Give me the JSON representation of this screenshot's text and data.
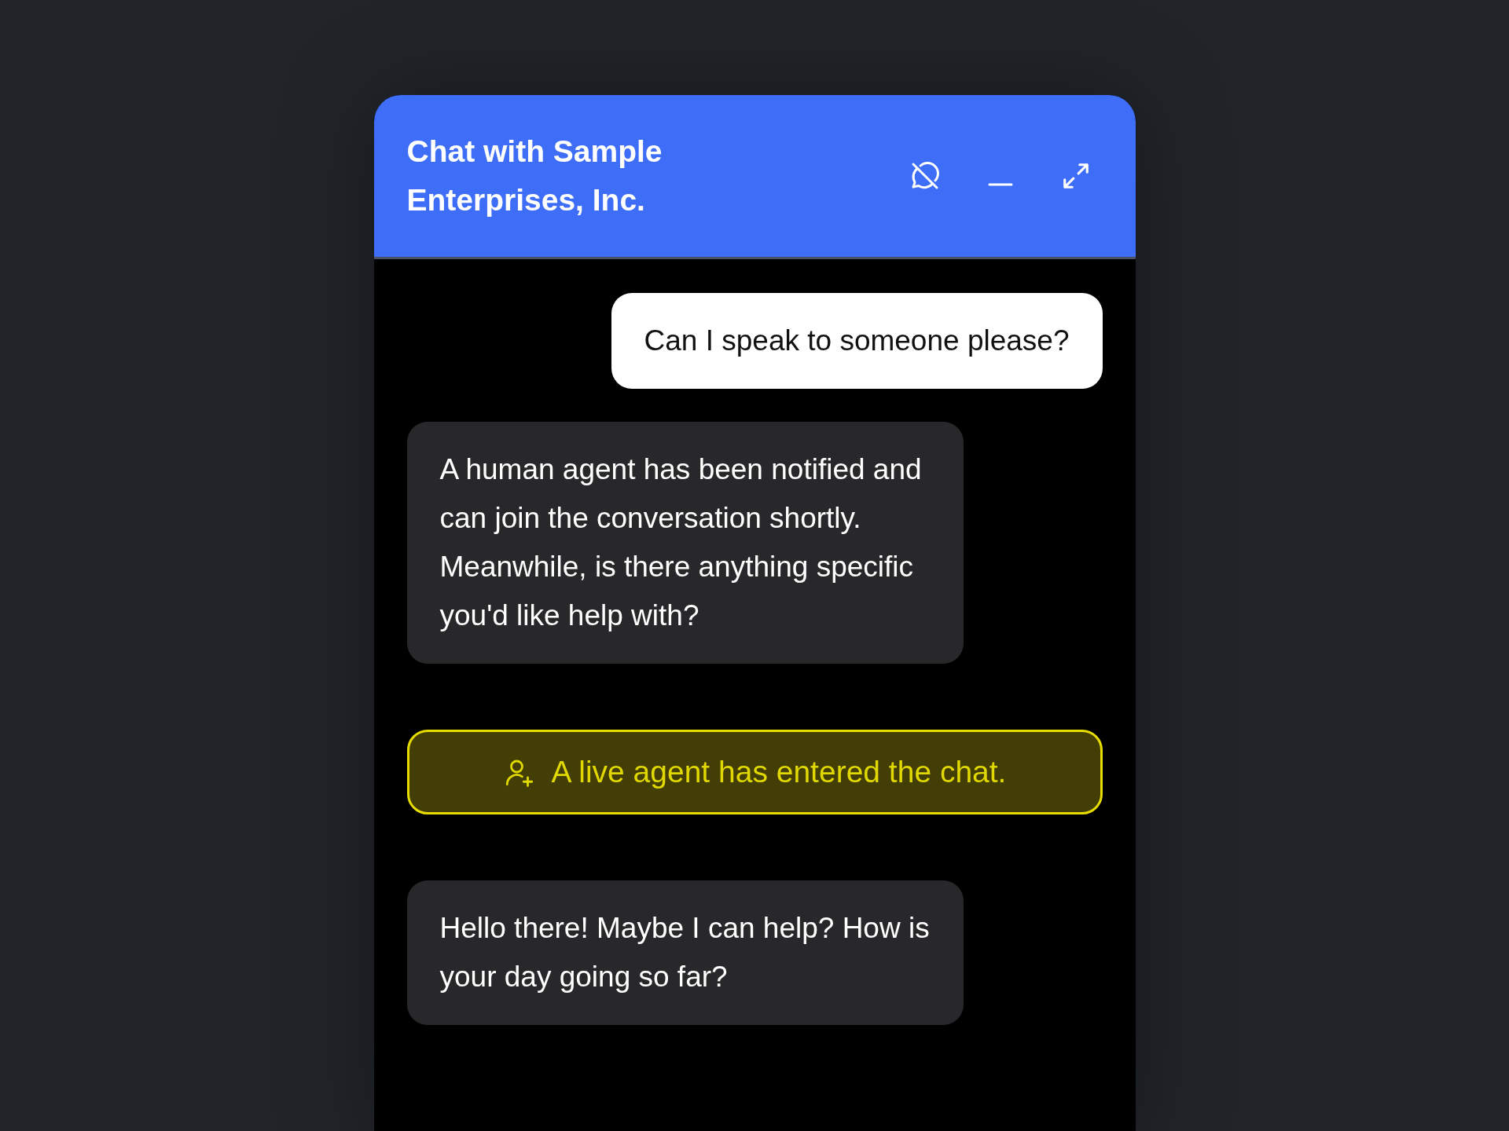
{
  "header": {
    "title": "Chat with Sample Enterprises, Inc."
  },
  "messages": [
    {
      "kind": "user",
      "text": "Can I speak to someone please?"
    },
    {
      "kind": "bot",
      "text": "A human agent has been notified and can join the conversation shortly. Meanwhile, is there anything specific you'd like help with?"
    },
    {
      "kind": "event",
      "text": "A live agent has entered the chat."
    },
    {
      "kind": "bot",
      "text": "Hello there! Maybe I can help? How is your day going so far?"
    }
  ]
}
